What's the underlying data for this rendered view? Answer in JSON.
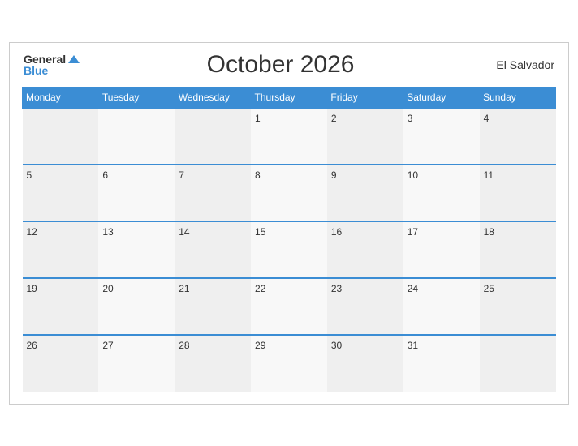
{
  "header": {
    "logo_general": "General",
    "logo_blue": "Blue",
    "month_title": "October 2026",
    "country": "El Salvador"
  },
  "weekdays": [
    "Monday",
    "Tuesday",
    "Wednesday",
    "Thursday",
    "Friday",
    "Saturday",
    "Sunday"
  ],
  "weeks": [
    [
      "",
      "",
      "",
      "1",
      "2",
      "3",
      "4"
    ],
    [
      "5",
      "6",
      "7",
      "8",
      "9",
      "10",
      "11"
    ],
    [
      "12",
      "13",
      "14",
      "15",
      "16",
      "17",
      "18"
    ],
    [
      "19",
      "20",
      "21",
      "22",
      "23",
      "24",
      "25"
    ],
    [
      "26",
      "27",
      "28",
      "29",
      "30",
      "31",
      ""
    ]
  ]
}
